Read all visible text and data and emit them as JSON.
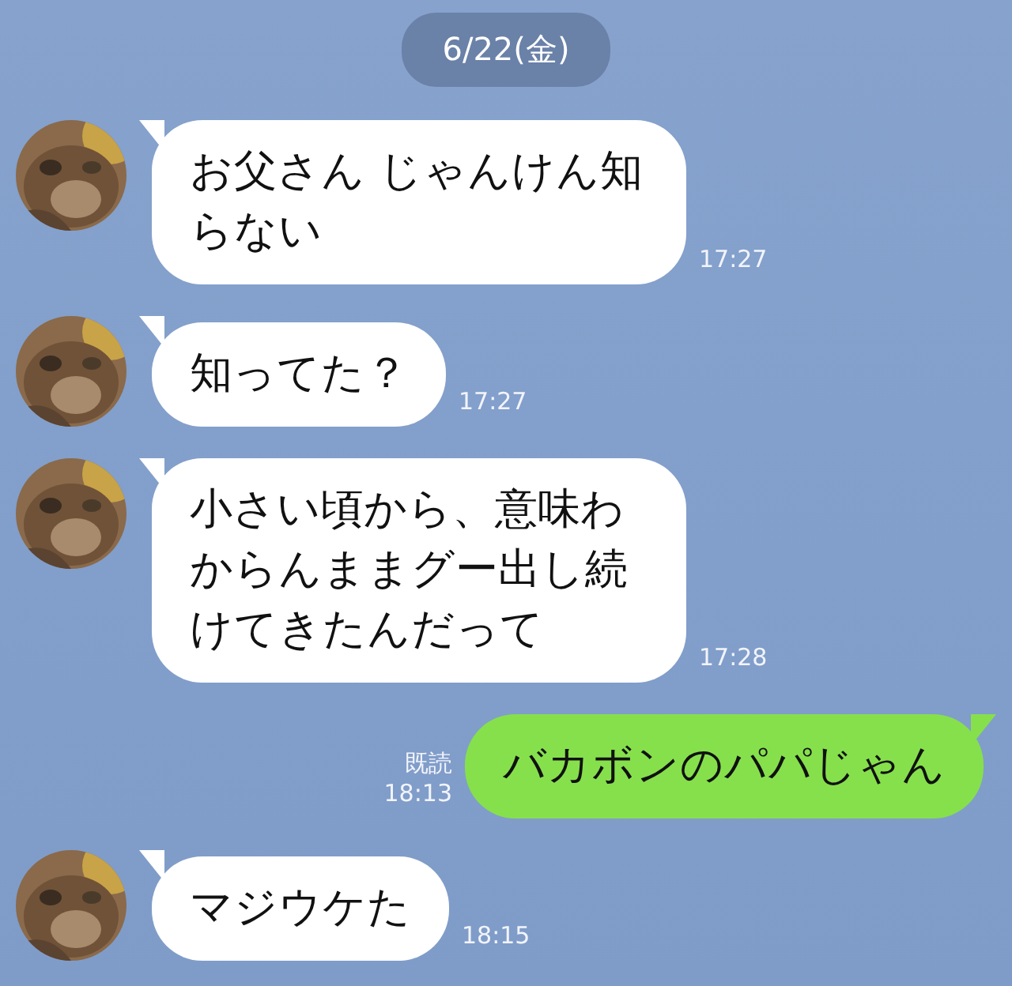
{
  "date": "6/22(金)",
  "messages": [
    {
      "kind": "received",
      "text": "お父さん じゃんけん知らない",
      "time": "17:27"
    },
    {
      "kind": "received",
      "text": "知ってた？",
      "time": "17:27"
    },
    {
      "kind": "received",
      "text": "小さい頃から、意味わからんままグー出し続けてきたんだって",
      "time": "17:28"
    },
    {
      "kind": "sent",
      "text": "バカボンのパパじゃん",
      "read": "既読",
      "time": "18:13"
    },
    {
      "kind": "received",
      "text": "マジウケた",
      "time": "18:15"
    }
  ]
}
